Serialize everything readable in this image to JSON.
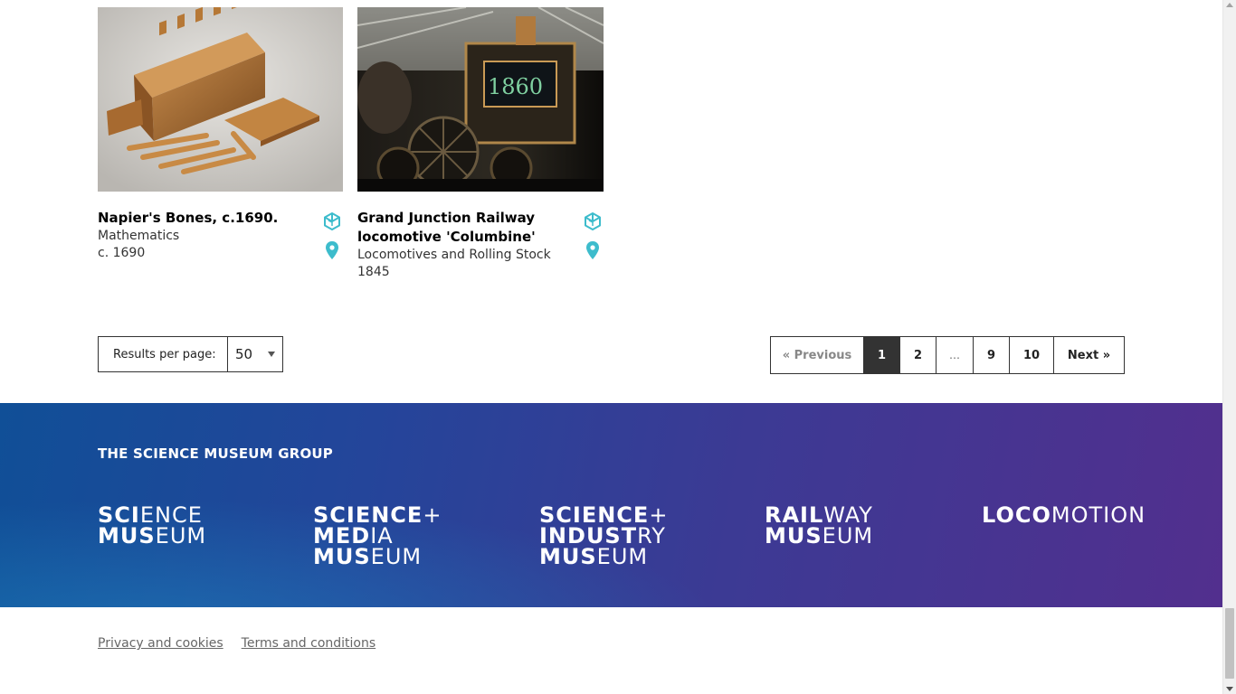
{
  "results": [
    {
      "title": "Napier's Bones, c.1690.",
      "category": "Mathematics",
      "date": "c. 1690",
      "image": "napiers-bones-photo",
      "icons": [
        "3d-cube-icon",
        "location-pin-icon"
      ]
    },
    {
      "title": "Grand Junction Railway locomotive 'Columbine'",
      "category": "Locomotives and Rolling Stock",
      "date": "1845",
      "image": "columbine-locomotive-photo",
      "icons": [
        "3d-cube-icon",
        "location-pin-icon"
      ]
    }
  ],
  "results_per_page": {
    "label": "Results per page:",
    "value": "50"
  },
  "pagination": {
    "previous": "«  Previous",
    "pages": [
      "1",
      "2",
      "…",
      "9",
      "10"
    ],
    "current": "1",
    "next": "Next  »"
  },
  "footer": {
    "group_title": "THE SCIENCE MUSEUM GROUP",
    "logos": [
      {
        "lines": [
          {
            "bold": "SCI",
            "light": "ENCE"
          },
          {
            "bold": "MUS",
            "light": "EUM"
          }
        ]
      },
      {
        "lines": [
          {
            "bold": "SCIENCE",
            "light": "+"
          },
          {
            "bold": "MED",
            "light": "IA"
          },
          {
            "bold": "MUS",
            "light": "EUM"
          }
        ]
      },
      {
        "lines": [
          {
            "bold": "SCIENCE",
            "light": "+"
          },
          {
            "bold": "INDUST",
            "light": "RY"
          },
          {
            "bold": "MUS",
            "light": "EUM"
          }
        ]
      },
      {
        "lines": [
          {
            "bold": "RAIL",
            "light": "WAY"
          },
          {
            "bold": "MUS",
            "light": "EUM"
          }
        ]
      },
      {
        "lines": [
          {
            "bold": "LOCO",
            "light": "MOTION"
          }
        ]
      }
    ]
  },
  "links": {
    "privacy": "Privacy and cookies",
    "terms": "Terms and conditions"
  },
  "colors": {
    "icon_accent": "#3dbccc",
    "footer_gradient_start": "#104f97",
    "footer_gradient_end": "#522f8e",
    "active_page_bg": "#333333"
  }
}
